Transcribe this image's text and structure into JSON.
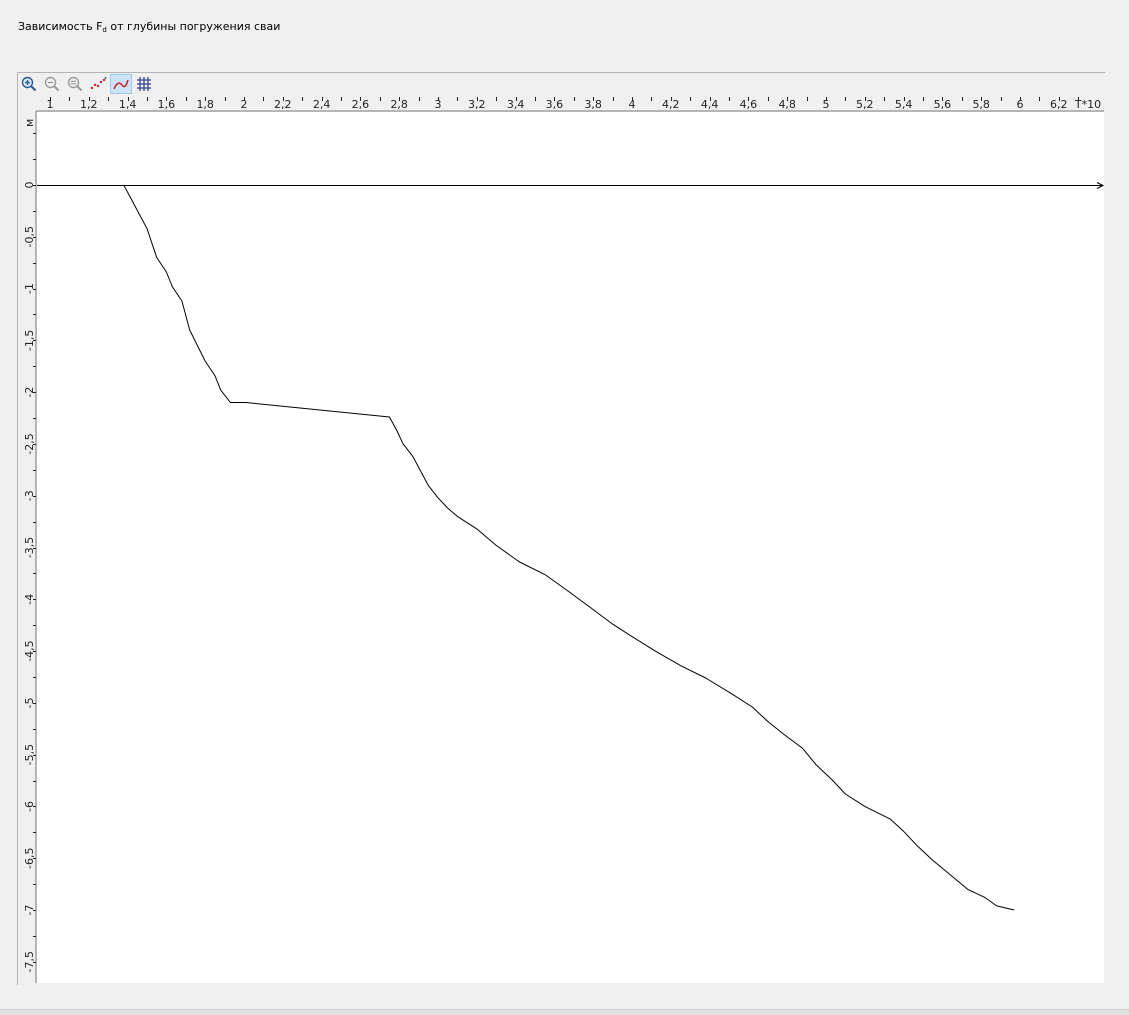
{
  "window": {
    "title_main": "Зависимость F",
    "title_sub": "d",
    "title_rest": " от глубины погружения сваи"
  },
  "toolbar": {
    "buttons": [
      {
        "name": "zoom-in-icon",
        "active": false
      },
      {
        "name": "zoom-out-icon",
        "active": false
      },
      {
        "name": "zoom-reset-icon",
        "active": false
      },
      {
        "name": "points-mode-icon",
        "active": false
      },
      {
        "name": "line-mode-icon",
        "active": true
      },
      {
        "name": "grid-icon",
        "active": false
      }
    ]
  },
  "chart_data": {
    "type": "line",
    "title": "Зависимость Fd от глубины погружения сваи",
    "xlabel": "T*10",
    "ylabel": "м",
    "xlim": [
      0.93,
      6.4
    ],
    "ylim": [
      -7.7,
      0.7
    ],
    "grid": false,
    "x_ticks": [
      1,
      1.2,
      1.4,
      1.6,
      1.8,
      2,
      2.2,
      2.4,
      2.6,
      2.8,
      3,
      3.2,
      3.4,
      3.6,
      3.8,
      4,
      4.2,
      4.4,
      4.6,
      4.8,
      5,
      5.2,
      5.4,
      5.6,
      5.8,
      6,
      6.2
    ],
    "x_tick_labels": [
      "1",
      "1,2",
      "1,4",
      "1,6",
      "1,8",
      "2",
      "2,2",
      "2,4",
      "2,6",
      "2,8",
      "3",
      "3,2",
      "3,4",
      "3,6",
      "3,8",
      "4",
      "4,2",
      "4,4",
      "4,6",
      "4,8",
      "5",
      "5,2",
      "5,4",
      "5,6",
      "5,8",
      "6",
      "6,2"
    ],
    "y_ticks": [
      0,
      -0.5,
      -1,
      -1.5,
      -2,
      -2.5,
      -3,
      -3.5,
      -4,
      -4.5,
      -5,
      -5.5,
      -6,
      -6.5,
      -7,
      -7.5
    ],
    "y_tick_labels": [
      "0",
      "-0,5",
      "-1",
      "-1,5",
      "-2",
      "-2,5",
      "-3",
      "-3,5",
      "-4",
      "-4,5",
      "-5",
      "-5,5",
      "-6",
      "-6,5",
      "-7",
      "-7,5"
    ],
    "series": [
      {
        "color": "#000000",
        "x": [
          1.38,
          1.42,
          1.46,
          1.5,
          1.55,
          1.6,
          1.63,
          1.68,
          1.72,
          1.76,
          1.8,
          1.85,
          1.88,
          1.93,
          1.97,
          2.01,
          2.75,
          2.79,
          2.82,
          2.87,
          2.91,
          2.95,
          3.0,
          3.05,
          3.1,
          3.2,
          3.3,
          3.42,
          3.55,
          3.67,
          3.8,
          3.9,
          4.0,
          4.12,
          4.25,
          4.38,
          4.52,
          4.62,
          4.7,
          4.78,
          4.88,
          4.95,
          5.03,
          5.1,
          5.2,
          5.33,
          5.4,
          5.47,
          5.55,
          5.64,
          5.73,
          5.82,
          5.88,
          5.97
        ],
        "y": [
          0,
          -0.14,
          -0.28,
          -0.42,
          -0.7,
          -0.84,
          -0.98,
          -1.12,
          -1.4,
          -1.55,
          -1.7,
          -1.84,
          -1.98,
          -2.1,
          -2.1,
          -2.1,
          -2.24,
          -2.38,
          -2.5,
          -2.62,
          -2.76,
          -2.9,
          -3.02,
          -3.12,
          -3.2,
          -3.32,
          -3.48,
          -3.64,
          -3.76,
          -3.92,
          -4.1,
          -4.24,
          -4.36,
          -4.5,
          -4.64,
          -4.76,
          -4.92,
          -5.04,
          -5.18,
          -5.3,
          -5.44,
          -5.6,
          -5.74,
          -5.88,
          -6.0,
          -6.12,
          -6.24,
          -6.38,
          -6.52,
          -6.66,
          -6.8,
          -6.88,
          -6.96,
          -7.0
        ]
      }
    ]
  }
}
